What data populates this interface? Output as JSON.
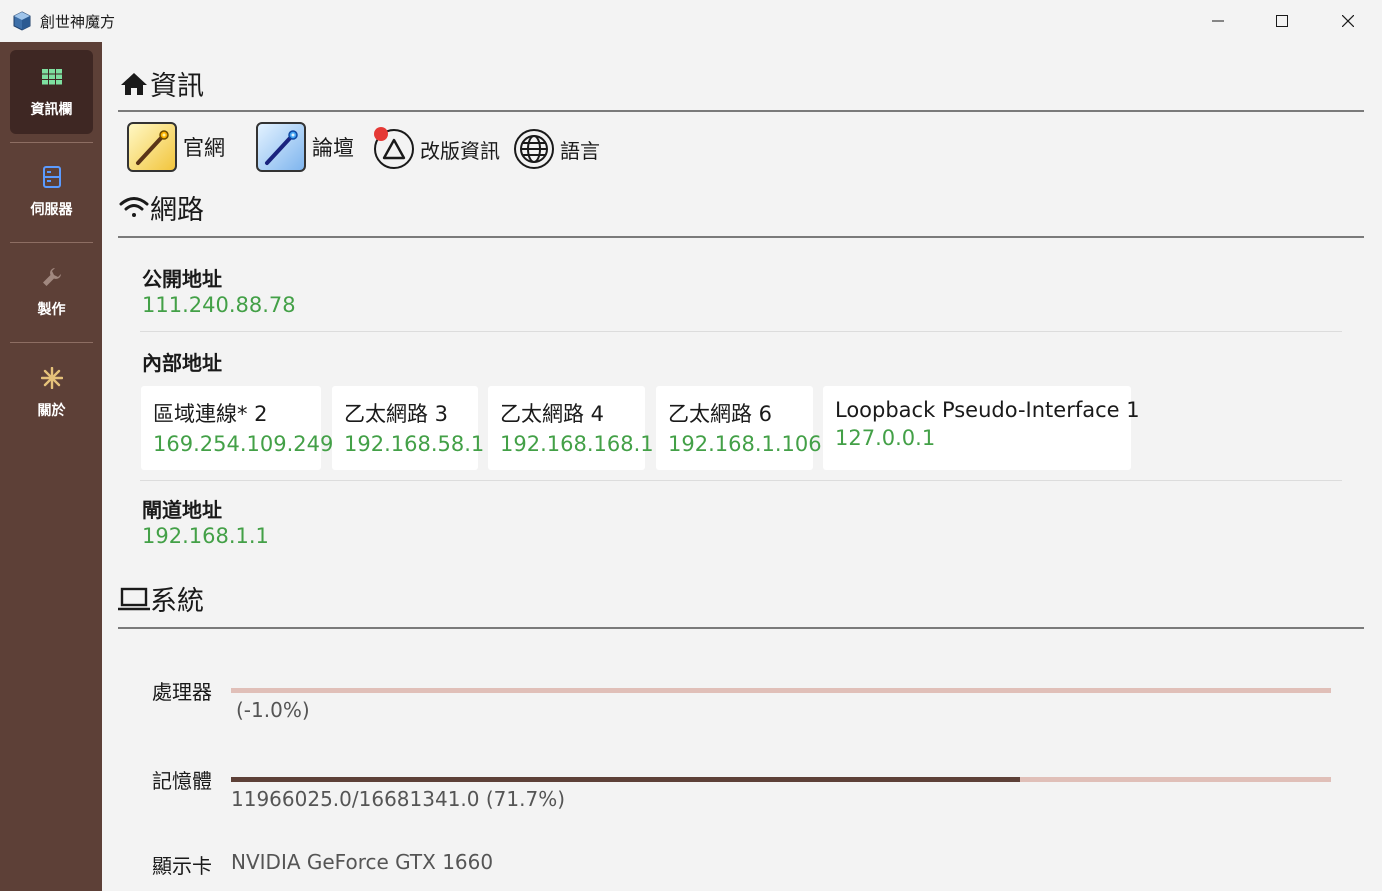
{
  "window": {
    "title": "創世神魔方"
  },
  "sidebar": {
    "items": [
      {
        "label": "資訊欄",
        "icon": "grid-icon",
        "active": true
      },
      {
        "label": "伺服器",
        "icon": "server-icon",
        "active": false
      },
      {
        "label": "製作",
        "icon": "wrench-icon",
        "active": false
      },
      {
        "label": "關於",
        "icon": "snowflake-icon",
        "active": false
      }
    ]
  },
  "info": {
    "title": "資訊",
    "links": [
      {
        "label": "官網",
        "icon": "staff-icon"
      },
      {
        "label": "論壇",
        "icon": "staff-icon"
      },
      {
        "label": "改版資訊",
        "icon": "triangle-icon"
      },
      {
        "label": "語言",
        "icon": "globe-icon"
      }
    ]
  },
  "network": {
    "title": "網路",
    "public_label": "公開地址",
    "public_value": "111.240.88.78",
    "internal_label": "內部地址",
    "interfaces": [
      {
        "name": "區域連線* 2",
        "ip": "169.254.109.249"
      },
      {
        "name": "乙太網路 3",
        "ip": "192.168.58.1"
      },
      {
        "name": "乙太網路 4",
        "ip": "192.168.168.1"
      },
      {
        "name": "乙太網路 6",
        "ip": "192.168.1.106"
      },
      {
        "name": "Loopback Pseudo-Interface 1",
        "ip": "127.0.0.1"
      }
    ],
    "gateway_label": "閘道地址",
    "gateway_value": "192.168.1.1"
  },
  "system": {
    "title": "系統",
    "cpu_label": "處理器",
    "cpu_text": "(-1.0%)",
    "cpu_fraction": 0.0,
    "mem_label": "記憶體",
    "mem_text": "11966025.0/16681341.0 (71.7%)",
    "mem_fraction": 0.717,
    "gpu_label": "顯示卡",
    "gpu_value": "NVIDIA GeForce GTX 1660"
  },
  "colors": {
    "sidebar_bg": "#5d4037",
    "sidebar_active": "#3e2723",
    "accent_green": "#43a047",
    "bar_track": "#e0bfb8",
    "bar_fill": "#5d4037"
  }
}
